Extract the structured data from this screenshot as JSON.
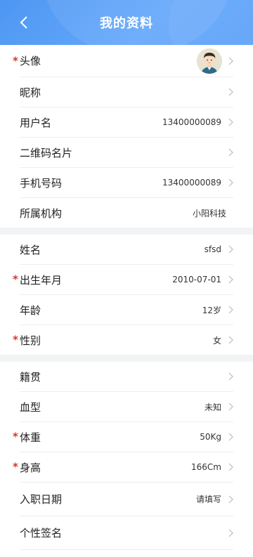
{
  "header": {
    "title": "我的资料",
    "back_icon": "chevron-left-icon"
  },
  "colors": {
    "header_blue": "#5ea2f8",
    "required_red": "#e0302a"
  },
  "groups": [
    {
      "rows": [
        {
          "label": "头像",
          "value": "",
          "required": true,
          "avatar": true
        },
        {
          "label": "昵称",
          "value": "",
          "required": false
        },
        {
          "label": "用户名",
          "value": "13400000089",
          "required": false
        },
        {
          "label": "二维码名片",
          "value": "",
          "required": false
        },
        {
          "label": "手机号码",
          "value": "13400000089",
          "required": false
        },
        {
          "label": "所属机构",
          "value": "小阳科技",
          "required": false
        }
      ]
    },
    {
      "rows": [
        {
          "label": "姓名",
          "value": "sfsd",
          "required": false
        },
        {
          "label": "出生年月",
          "value": "2010-07-01",
          "required": true
        },
        {
          "label": "年龄",
          "value": "12岁",
          "required": false
        },
        {
          "label": "性别",
          "value": "女",
          "required": true
        }
      ]
    },
    {
      "rows": [
        {
          "label": "籍贯",
          "value": "",
          "required": false
        },
        {
          "label": "血型",
          "value": "未知",
          "required": false
        },
        {
          "label": "体重",
          "value": "50Kg",
          "required": true
        },
        {
          "label": "身高",
          "value": "166Cm",
          "required": true
        },
        {
          "label": "入职日期",
          "value": "请填写",
          "required": false
        },
        {
          "label": "个性签名",
          "value": "",
          "required": false
        }
      ]
    }
  ]
}
